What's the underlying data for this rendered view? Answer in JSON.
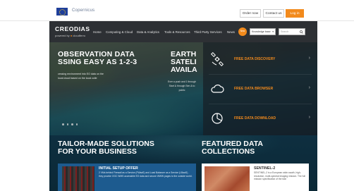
{
  "topbar": {
    "copernicus_label": "Copernicus",
    "order_label": "Order now",
    "contact_label": "Contact us",
    "login_label": "Log in"
  },
  "navbar": {
    "brand": "CREODIAS",
    "powered_prefix": "powered by",
    "powered_name": "cloudferro",
    "items": [
      {
        "label": "Home"
      },
      {
        "label": "Computing & Cloud"
      },
      {
        "label": "Data & Analytics"
      },
      {
        "label": "Tools & Resources"
      },
      {
        "label": "Third Party Services"
      },
      {
        "label": "News"
      }
    ],
    "badge_text": "New",
    "select_value": "Knowledge base",
    "search_placeholder": "Search"
  },
  "hero": {
    "title_line1": "OBSERVATION DATA",
    "title_line2": "SSING EASY AS 1-2-3",
    "subtitle": "cessing environment into EO data on the local cloud based on the local colle",
    "mid_title_line1": "EARTH",
    "mid_title_line2": "SATELI",
    "mid_title_line3": "AVAILA",
    "mid_text": "Ever a push and 1 through Start & through Sen & to public"
  },
  "features": [
    {
      "label": "FREE DATA DISCOVERY",
      "icon": "satellite-icon"
    },
    {
      "label": "FREE DATA BROWSER",
      "icon": "cloud-icon"
    },
    {
      "label": "FREE DATA DOWNLOAD",
      "icon": "chart-icon"
    }
  ],
  "lower": {
    "left_title_line1": "TAILOR-MADE SOLUTIONS",
    "left_title_line2": "FOR YOUR BUSINESS",
    "right_title_line1": "FEATURED DATA",
    "right_title_line2": "COLLECTIONS",
    "offer_title": "INITIAL SETUP OFFER",
    "offer_text": "2 VMs behind Firewall as a Service (FWaaS) and Load Balancer as a Service (LBaaS) - they provide OGC WMS accessible EO data and secure WWW pages to the outside world.",
    "coll_title": "SENTINEL-2",
    "coll_text": "SENTINEL-2 is a European wide-swath, high-resolution, multi-spectral imaging mission. The full mission specification of the twin"
  },
  "colors": {
    "accent": "#f28a1c",
    "nav_bg": "#2d3034",
    "offer_bg": "#1d5b8f"
  }
}
